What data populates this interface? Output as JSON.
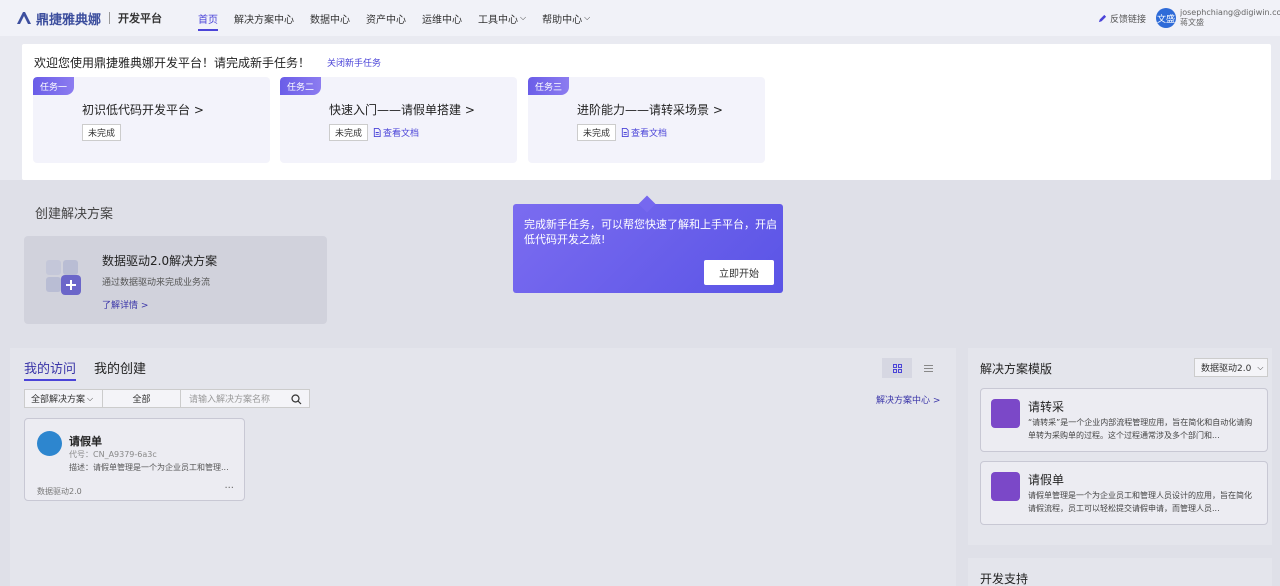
{
  "header": {
    "logo_text": "鼎捷雅典娜",
    "platform": "开发平台",
    "menu": [
      {
        "label": "首页",
        "active": true
      },
      {
        "label": "解决方案中心"
      },
      {
        "label": "数据中心"
      },
      {
        "label": "资产中心"
      },
      {
        "label": "运维中心"
      },
      {
        "label": "工具中心"
      },
      {
        "label": "帮助中心"
      }
    ],
    "feedback_label": "反馈链接",
    "avatar_text": "文盛",
    "user_email": "josephchiang@digiwin.com",
    "user_name": "蒋文盛"
  },
  "guide": {
    "welcome": "欢迎您使用鼎捷雅典娜开发平台！请完成新手任务！",
    "close_label": "关闭新手任务",
    "tasks": [
      {
        "tag": "任务一",
        "title": "初识低代码开发平台 >",
        "status": "未完成"
      },
      {
        "tag": "任务二",
        "title": "快速入门——请假单搭建 >",
        "status": "未完成",
        "doc": "查看文档"
      },
      {
        "tag": "任务三",
        "title": "进阶能力——请转采场景 >",
        "status": "未完成",
        "doc": "查看文档"
      }
    ]
  },
  "popover": {
    "text": "完成新手任务，可以帮您快速了解和上手平台，开启低代码开发之旅!",
    "button": "立即开始"
  },
  "create": {
    "title": "创建解决方案",
    "card": {
      "title": "数据驱动2.0解决方案",
      "desc": "通过数据驱动来完成业务流",
      "link": "了解详情 >"
    }
  },
  "visits": {
    "tabs": [
      "我的访问",
      "我的创建"
    ],
    "filter_solution": "全部解决方案",
    "filter_all": "全部",
    "search_placeholder": "请输入解决方案名称",
    "center_link": "解决方案中心 >",
    "apps": [
      {
        "name": "请假单",
        "code": "代号：CN_A9379-6a3c",
        "desc": "描述：请假单管理是一个为企业员工和管理...",
        "footer": "数据驱动2.0",
        "more": "···"
      }
    ]
  },
  "templates": {
    "title": "解决方案模版",
    "select": "数据驱动2.0",
    "items": [
      {
        "name": "请转采",
        "desc": "“请转采”是一个企业内部流程管理应用，旨在简化和自动化请购单转为采购单的过程。这个过程通常涉及多个部门和..."
      },
      {
        "name": "请假单",
        "desc": "请假单管理是一个为企业员工和管理人员设计的应用，旨在简化请假流程，员工可以轻松提交请假申请，而管理人员..."
      }
    ]
  },
  "support": {
    "title": "开发支持"
  }
}
